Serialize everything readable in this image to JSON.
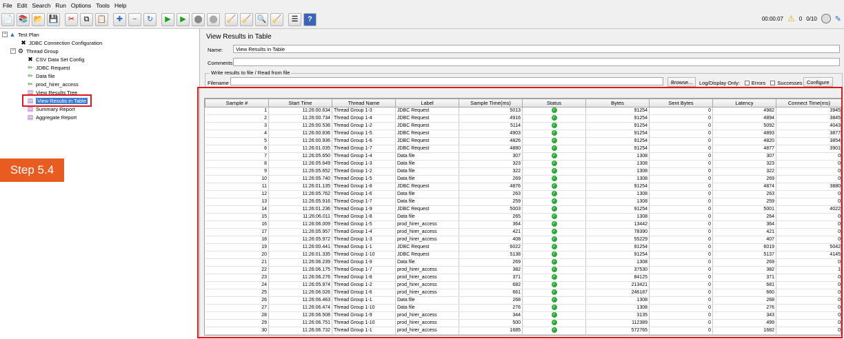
{
  "menu": [
    "File",
    "Edit",
    "Search",
    "Run",
    "Options",
    "Tools",
    "Help"
  ],
  "status": {
    "elapsed": "00:00:07",
    "warnings": "0",
    "threads": "0/10"
  },
  "tree": {
    "test_plan": "Test Plan",
    "jdbc_connection": "JDBC Connection Configuration",
    "thread_group": "Thread Group",
    "csv_config": "CSV Data Set Config",
    "jdbc_request": "JDBC Request",
    "data_file": "Data file",
    "prod_hirer": "prod_hirer_access",
    "view_tree": "View Results Tree",
    "view_table": "View Results in Table",
    "summary": "Summary Report",
    "aggregate": "Aggregate Report"
  },
  "overlay": {
    "step_label": "Step 5.4"
  },
  "panel": {
    "title": "View Results in Table",
    "name_label": "Name:",
    "name_value": "View Results in Table",
    "comments_label": "Comments:",
    "comments_value": "",
    "write_group_title": "Write results to file / Read from file",
    "filename_label": "Filename",
    "filename_value": "",
    "browse": "Browse...",
    "log_display": "Log/Display Only:",
    "errors": "Errors",
    "successes": "Successes",
    "configure": "Configure"
  },
  "table": {
    "columns": [
      "Sample #",
      "Start Time",
      "Thread Name",
      "Label",
      "Sample Time(ms)",
      "Status",
      "Bytes",
      "Sent Bytes",
      "Latency",
      "Connect Time(ms)"
    ],
    "rows": [
      [
        "1",
        "11:26:00.634",
        "Thread Group 1-3",
        "JDBC Request",
        "5013",
        "91254",
        "0",
        "4982",
        "3945"
      ],
      [
        "2",
        "11:26:00.734",
        "Thread Group 1-4",
        "JDBC Request",
        "4916",
        "91254",
        "0",
        "4894",
        "3845"
      ],
      [
        "3",
        "11:26:00.536",
        "Thread Group 1-2",
        "JDBC Request",
        "5114",
        "91254",
        "0",
        "5092",
        "4043"
      ],
      [
        "4",
        "11:26:00.836",
        "Thread Group 1-5",
        "JDBC Request",
        "4903",
        "91254",
        "0",
        "4893",
        "3877"
      ],
      [
        "5",
        "11:26:00.936",
        "Thread Group 1-6",
        "JDBC Request",
        "4826",
        "91254",
        "0",
        "4820",
        "3854"
      ],
      [
        "6",
        "11:26:01.035",
        "Thread Group 1-7",
        "JDBC Request",
        "4880",
        "91254",
        "0",
        "4877",
        "3901"
      ],
      [
        "7",
        "11:26:05.650",
        "Thread Group 1-4",
        "Data file",
        "307",
        "1308",
        "0",
        "307",
        "0"
      ],
      [
        "8",
        "11:26:05.649",
        "Thread Group 1-3",
        "Data file",
        "323",
        "1308",
        "0",
        "323",
        "0"
      ],
      [
        "9",
        "11:26:05.652",
        "Thread Group 1-2",
        "Data file",
        "322",
        "1308",
        "0",
        "322",
        "0"
      ],
      [
        "10",
        "11:26:05.740",
        "Thread Group 1-5",
        "Data file",
        "269",
        "1308",
        "0",
        "269",
        "0"
      ],
      [
        "11",
        "11:26:01.135",
        "Thread Group 1-8",
        "JDBC Request",
        "4876",
        "91254",
        "0",
        "4874",
        "3880"
      ],
      [
        "12",
        "11:26:05.762",
        "Thread Group 1-6",
        "Data file",
        "263",
        "1308",
        "0",
        "263",
        "0"
      ],
      [
        "13",
        "11:26:05.916",
        "Thread Group 1-7",
        "Data file",
        "259",
        "1308",
        "0",
        "259",
        "0"
      ],
      [
        "14",
        "11:26:01.236",
        "Thread Group 1-9",
        "JDBC Request",
        "5003",
        "91254",
        "0",
        "5001",
        "4022"
      ],
      [
        "15",
        "11:26:06.011",
        "Thread Group 1-8",
        "Data file",
        "265",
        "1308",
        "0",
        "264",
        "0"
      ],
      [
        "16",
        "11:26:06.009",
        "Thread Group 1-5",
        "prod_hirer_access",
        "364",
        "13442",
        "0",
        "364",
        "0"
      ],
      [
        "17",
        "11:26:05.957",
        "Thread Group 1-4",
        "prod_hirer_access",
        "421",
        "78390",
        "0",
        "421",
        "0"
      ],
      [
        "18",
        "11:26:05.972",
        "Thread Group 1-3",
        "prod_hirer_access",
        "408",
        "55229",
        "0",
        "407",
        "0"
      ],
      [
        "19",
        "11:26:00.441",
        "Thread Group 1-1",
        "JDBC Request",
        "6022",
        "91254",
        "0",
        "6019",
        "5042"
      ],
      [
        "20",
        "11:26:01.335",
        "Thread Group 1-10",
        "JDBC Request",
        "5138",
        "91254",
        "0",
        "5137",
        "4145"
      ],
      [
        "21",
        "11:26:06.239",
        "Thread Group 1-9",
        "Data file",
        "269",
        "1308",
        "0",
        "269",
        "0"
      ],
      [
        "22",
        "11:26:06.175",
        "Thread Group 1-7",
        "prod_hirer_access",
        "382",
        "37530",
        "0",
        "382",
        "1"
      ],
      [
        "23",
        "11:26:06.276",
        "Thread Group 1-8",
        "prod_hirer_access",
        "371",
        "84125",
        "0",
        "371",
        "0"
      ],
      [
        "24",
        "11:26:05.974",
        "Thread Group 1-2",
        "prod_hirer_access",
        "682",
        "213421",
        "0",
        "681",
        "0"
      ],
      [
        "25",
        "11:26:06.026",
        "Thread Group 1-6",
        "prod_hirer_access",
        "661",
        "246187",
        "0",
        "660",
        "0"
      ],
      [
        "26",
        "11:26:06.463",
        "Thread Group 1-1",
        "Data file",
        "268",
        "1308",
        "0",
        "268",
        "0"
      ],
      [
        "27",
        "11:26:06.474",
        "Thread Group 1-10",
        "Data file",
        "276",
        "1308",
        "0",
        "276",
        "0"
      ],
      [
        "28",
        "11:26:06.508",
        "Thread Group 1-9",
        "prod_hirer_access",
        "344",
        "3135",
        "0",
        "343",
        "0"
      ],
      [
        "29",
        "11:26:06.751",
        "Thread Group 1-10",
        "prod_hirer_access",
        "500",
        "112389",
        "0",
        "499",
        "0"
      ],
      [
        "30",
        "11:26:06.732",
        "Thread Group 1-1",
        "prod_hirer_access",
        "1685",
        "572765",
        "0",
        "1682",
        "0"
      ]
    ]
  }
}
